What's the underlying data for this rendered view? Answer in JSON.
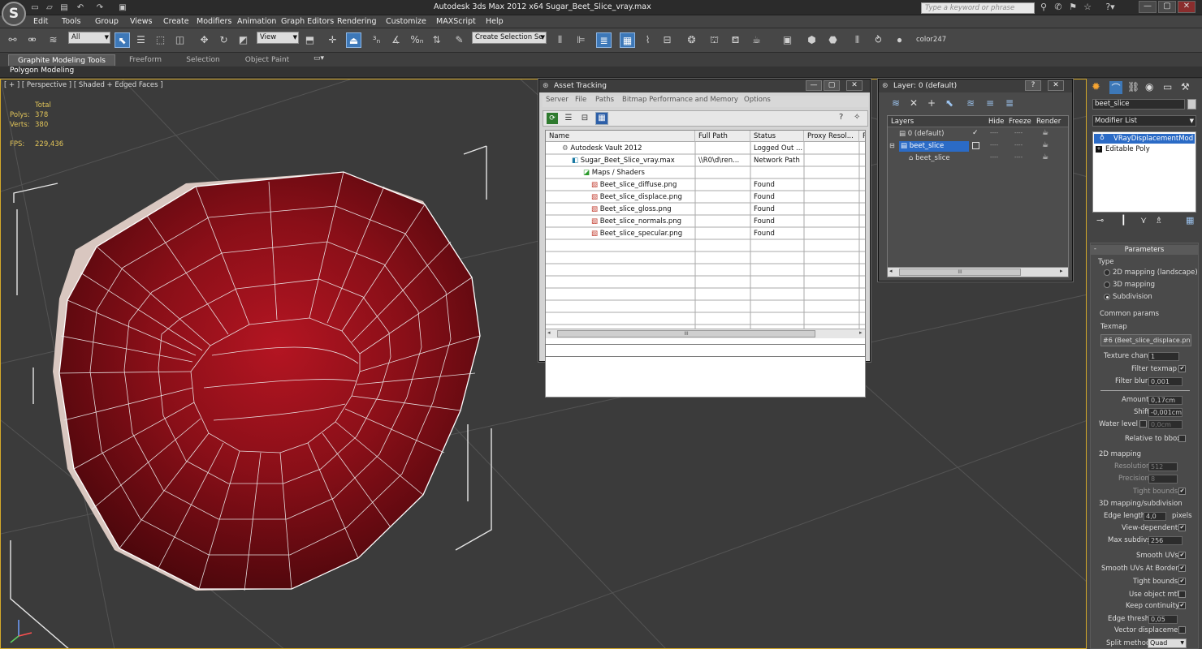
{
  "titlebar": {
    "app_title": "Autodesk 3ds Max  2012 x64     Sugar_Beet_Slice_vray.max",
    "search_placeholder": "Type a keyword or phrase",
    "logo": "S"
  },
  "menubar": {
    "items": [
      "Edit",
      "Tools",
      "Group",
      "Views",
      "Create",
      "Modifiers",
      "Animation",
      "Graph Editors",
      "Rendering",
      "Customize",
      "MAXScript",
      "Help"
    ]
  },
  "toolbar": {
    "selection_filter": "All",
    "ref_coord": "View",
    "named_selection": "Create Selection Se",
    "color_label": "color247"
  },
  "ribbon": {
    "tabs": [
      "Graphite Modeling Tools",
      "Freeform",
      "Selection",
      "Object Paint"
    ],
    "sub_label": "Polygon Modeling"
  },
  "viewport": {
    "label": "[ + ] [ Perspective ] [ Shaded + Edged Faces ]",
    "stats": {
      "total_label": "Total",
      "polys_label": "Polys:",
      "polys": "378",
      "verts_label": "Verts:",
      "verts": "380",
      "fps_label": "FPS:",
      "fps": "229,436"
    }
  },
  "asset_tracking": {
    "title": "Asset Tracking",
    "menus": [
      "Server",
      "File",
      "Paths",
      "Bitmap Performance and Memory",
      "Options"
    ],
    "columns": [
      "Name",
      "Full Path",
      "Status",
      "Proxy Resol...",
      "P"
    ],
    "rows": [
      {
        "name": "Autodesk Vault 2012",
        "path": "",
        "status": "Logged Out ..."
      },
      {
        "name": "Sugar_Beet_Slice_vray.max",
        "path": "\\\\R0\\d\\ren...",
        "status": "Network Path"
      },
      {
        "name": "Maps / Shaders",
        "path": "",
        "status": ""
      },
      {
        "name": "Beet_slice_diffuse.png",
        "path": "",
        "status": "Found"
      },
      {
        "name": "Beet_slice_displace.png",
        "path": "",
        "status": "Found"
      },
      {
        "name": "Beet_slice_gloss.png",
        "path": "",
        "status": "Found"
      },
      {
        "name": "Beet_slice_normals.png",
        "path": "",
        "status": "Found"
      },
      {
        "name": "Beet_slice_specular.png",
        "path": "",
        "status": "Found"
      }
    ],
    "scroll_grip": "III"
  },
  "layer_window": {
    "title": "Layer: 0 (default)",
    "help_label": "?",
    "columns": [
      "Layers",
      "Hide",
      "Freeze",
      "Render"
    ],
    "rows": [
      {
        "name": "0 (default)",
        "selected": false
      },
      {
        "name": "beet_slice",
        "selected": true
      },
      {
        "name": "beet_slice",
        "selected": false
      }
    ],
    "dash": "----",
    "scroll_grip": "III"
  },
  "command_panel": {
    "object_name": "beet_slice",
    "modifier_list_label": "Modifier List",
    "stack": [
      "VRayDisplacementMod",
      "Editable Poly"
    ],
    "parameters_title": "Parameters",
    "type_label": "Type",
    "type_options": [
      "2D mapping (landscape)",
      "3D mapping",
      "Subdivision"
    ],
    "common_label": "Common params",
    "texmap_label": "Texmap",
    "texmap_value": "#6 (Beet_slice_displace.png)",
    "texture_chan_label": "Texture chan",
    "texture_chan": "1",
    "filter_texmap_label": "Filter texmap",
    "filter_blur_label": "Filter blur",
    "filter_blur": "0,001",
    "amount_label": "Amount",
    "amount": "0,17cm",
    "shift_label": "Shift",
    "shift": "-0,001cm",
    "water_label": "Water level",
    "water": "0,0cm",
    "relative_label": "Relative to bbox",
    "mapping2d_label": "2D mapping",
    "resolution_label": "Resolution",
    "resolution": "512",
    "precision_label": "Precision",
    "precision": "8",
    "tight_label": "Tight bounds",
    "mapping3d_label": "3D mapping/subdivision",
    "edge_len_label": "Edge length",
    "edge_len": "4,0",
    "pixels_label": "pixels",
    "view_dep_label": "View-dependent",
    "max_subdivs_label": "Max subdivs",
    "max_subdivs": "256",
    "smooth_uvs_label": "Smooth UVs",
    "smooth_borders_label": "Smooth UVs At Borders",
    "tight2_label": "Tight bounds",
    "use_obj_label": "Use object mtl",
    "keep_cont_label": "Keep continuity",
    "edge_thresh_label": "Edge thresh",
    "edge_thresh": "0,05",
    "vector_disp_label": "Vector displacement",
    "split_label": "Split method:",
    "split_value": "Quad"
  }
}
